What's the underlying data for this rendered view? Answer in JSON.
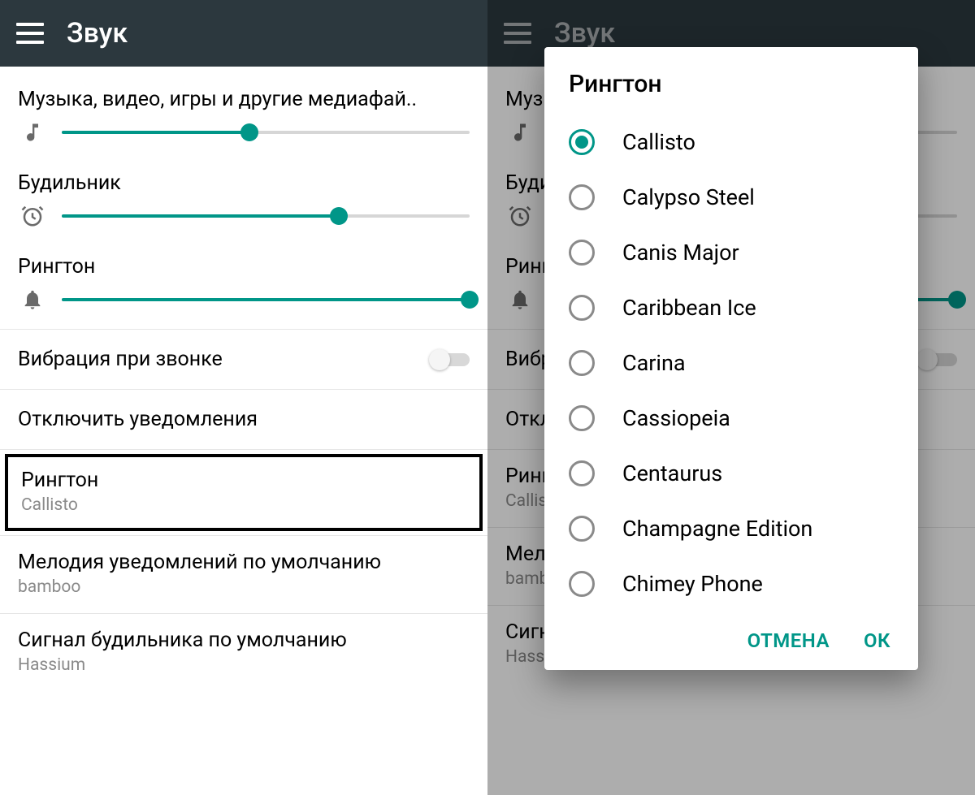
{
  "header": {
    "title": "Звук"
  },
  "sliders": {
    "media": {
      "label": "Музыка, видео, игры и другие медиафай..",
      "value": 46
    },
    "alarm": {
      "label": "Будильник",
      "value": 68
    },
    "ringtone": {
      "label": "Рингтон",
      "value": 100
    }
  },
  "settings": {
    "vibrate": {
      "label": "Вибрация при звонке",
      "on": false
    },
    "dnd": {
      "label": "Отключить уведомления"
    },
    "ringtone": {
      "title": "Рингтон",
      "value": "Callisto"
    },
    "notify": {
      "title": "Мелодия уведомлений по умолчанию",
      "value": "bamboo"
    },
    "alarm": {
      "title": "Сигнал будильника по умолчанию",
      "value": "Hassium"
    }
  },
  "dialog": {
    "title": "Рингтон",
    "options": [
      {
        "label": "Callisto",
        "selected": true
      },
      {
        "label": "Calypso Steel",
        "selected": false
      },
      {
        "label": "Canis Major",
        "selected": false
      },
      {
        "label": "Caribbean Ice",
        "selected": false
      },
      {
        "label": "Carina",
        "selected": false
      },
      {
        "label": "Cassiopeia",
        "selected": false
      },
      {
        "label": "Centaurus",
        "selected": false
      },
      {
        "label": "Champagne Edition",
        "selected": false
      },
      {
        "label": "Chimey Phone",
        "selected": false
      }
    ],
    "actions": {
      "cancel": "ОТМЕНА",
      "ok": "ОК"
    }
  },
  "colors": {
    "accent": "#009688"
  }
}
